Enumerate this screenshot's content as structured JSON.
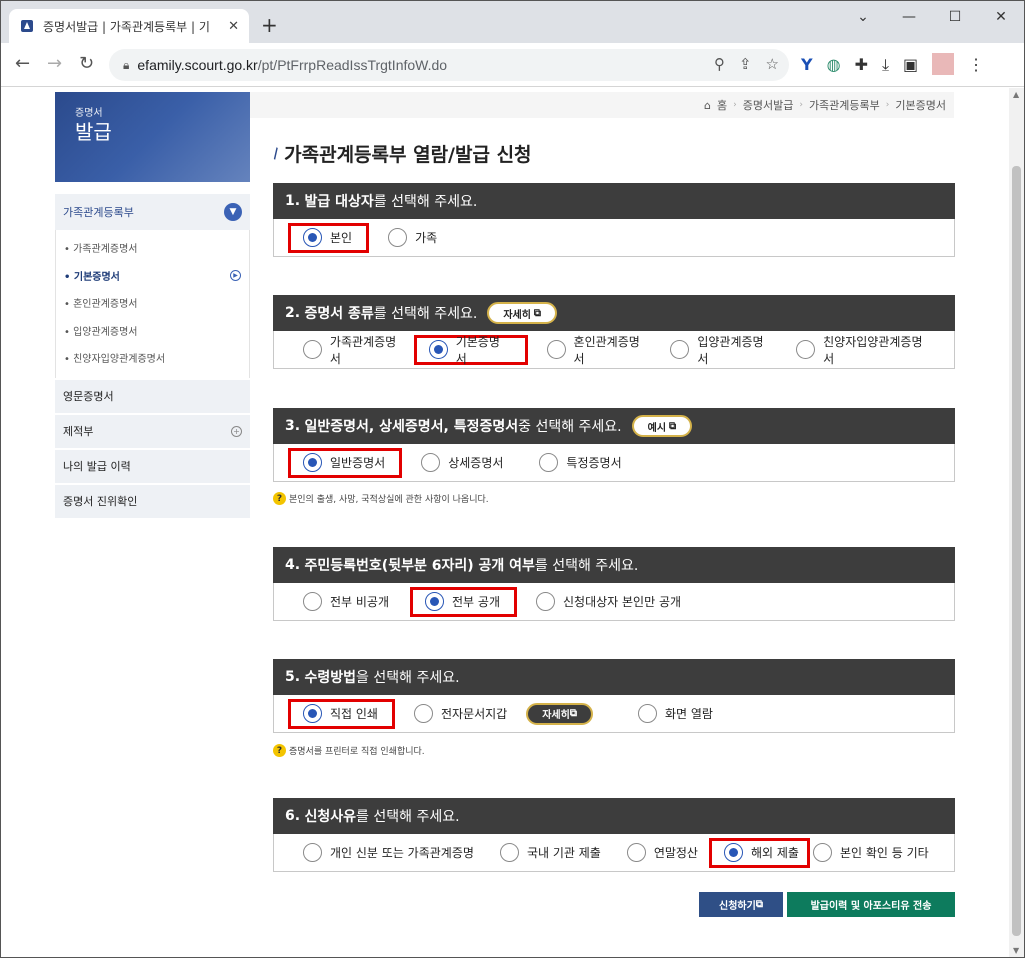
{
  "browser": {
    "tab_title": "증명서발급 | 가족관계등록부 | 기",
    "tab_close": "✕",
    "new_tab": "+",
    "url_host": "efamily.scourt.go.kr",
    "url_path": "/pt/PtFrrpReadIssTrgtInfoW.do"
  },
  "banner": {
    "line1": "증명서",
    "line2": "발급"
  },
  "sidebar": {
    "main_label": "가족관계등록부",
    "sub_items": [
      {
        "label": "가족관계증명서"
      },
      {
        "label": "기본증명서"
      },
      {
        "label": "혼인관계증명서"
      },
      {
        "label": "입양관계증명서"
      },
      {
        "label": "친양자입양관계증명서"
      }
    ],
    "rows": [
      {
        "label": "영문증명서"
      },
      {
        "label": "제적부"
      },
      {
        "label": "나의 발급 이력"
      },
      {
        "label": "증명서 진위확인"
      }
    ]
  },
  "breadcrumb": {
    "home": "홈",
    "level1": "증명서발급",
    "level2": "가족관계등록부",
    "level3": "기본증명서"
  },
  "page_title": "가족관계등록부 열람/발급 신청",
  "sections": [
    {
      "num": "1.",
      "bold": "발급 대상자",
      "rest": "를 선택해 주세요.",
      "options": [
        {
          "label": "본인"
        },
        {
          "label": "가족"
        }
      ]
    },
    {
      "num": "2.",
      "bold": "증명서 종류",
      "rest": "를 선택해 주세요.",
      "pill": "자세히",
      "options": [
        {
          "label": "가족관계증명서"
        },
        {
          "label": "기본증명서"
        },
        {
          "label": "혼인관계증명서"
        },
        {
          "label": "입양관계증명서"
        },
        {
          "label": "친양자입양관계증명서"
        }
      ]
    },
    {
      "num": "3.",
      "bold": "일반증명서, 상세증명서, 특정증명서",
      "rest": " 중 선택해 주세요.",
      "pill": "예시",
      "options": [
        {
          "label": "일반증명서"
        },
        {
          "label": "상세증명서"
        },
        {
          "label": "특정증명서"
        }
      ],
      "note": "본인의 출생, 사망, 국적상실에 관한 사항이 나옵니다."
    },
    {
      "num": "4.",
      "bold": "주민등록번호(뒷부분 6자리) 공개 여부",
      "rest": "를 선택해 주세요.",
      "options": [
        {
          "label": "전부 비공개"
        },
        {
          "label": "전부 공개"
        },
        {
          "label": "신청대상자 본인만 공개"
        }
      ]
    },
    {
      "num": "5.",
      "bold": "수령방법",
      "rest": "을 선택해 주세요.",
      "pill": "자세히",
      "options": [
        {
          "label": "직접 인쇄"
        },
        {
          "label": "전자문서지갑"
        },
        {
          "label": "화면 열람"
        }
      ],
      "note": "증명서를 프린터로 직접 인쇄합니다."
    },
    {
      "num": "6.",
      "bold": "신청사유",
      "rest": "를 선택해 주세요.",
      "options": [
        {
          "label": "개인 신분 또는 가족관계증명"
        },
        {
          "label": "국내 기관 제출"
        },
        {
          "label": "연말정산"
        },
        {
          "label": "해외 제출"
        },
        {
          "label": "본인 확인 등 기타"
        }
      ]
    }
  ],
  "buttons": {
    "apply": "신청하기",
    "send": "발급이력 및 아포스티유 전송"
  },
  "colors": {
    "accent": "#2856b6",
    "highlight": "#e20000",
    "header": "#3d3d3d",
    "apply": "#2f4f86",
    "send": "#0d7b5d"
  }
}
